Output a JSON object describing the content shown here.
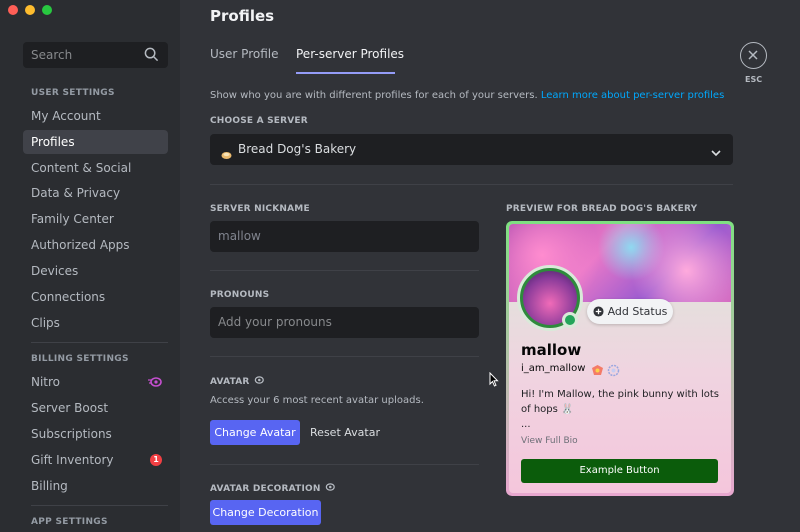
{
  "sidebar": {
    "search_placeholder": "Search",
    "sections": [
      {
        "heading": "USER SETTINGS",
        "items": [
          "My Account",
          "Profiles",
          "Content & Social",
          "Data & Privacy",
          "Family Center",
          "Authorized Apps",
          "Devices",
          "Connections",
          "Clips"
        ]
      },
      {
        "heading": "BILLING SETTINGS",
        "items": [
          "Nitro",
          "Server Boost",
          "Subscriptions",
          "Gift Inventory",
          "Billing"
        ]
      },
      {
        "heading": "APP SETTINGS",
        "items": []
      }
    ],
    "active_item": "Profiles",
    "gift_badge_count": "1"
  },
  "page": {
    "title": "Profiles",
    "tabs": [
      "User Profile",
      "Per-server Profiles"
    ],
    "active_tab": "Per-server Profiles",
    "description": "Show who you are with different profiles for each of your servers.",
    "learn_more": "Learn more about per-server profiles",
    "close_label": "ESC"
  },
  "form": {
    "choose_server_label": "CHOOSE A SERVER",
    "selected_server": "Bread Dog's Bakery",
    "nickname_label": "SERVER NICKNAME",
    "nickname_value": "mallow",
    "pronouns_label": "PRONOUNS",
    "pronouns_placeholder": "Add your pronouns",
    "avatar_label": "AVATAR",
    "avatar_desc": "Access your 6 most recent avatar uploads.",
    "change_avatar": "Change Avatar",
    "reset_avatar": "Reset Avatar",
    "decoration_label": "AVATAR DECORATION",
    "change_decoration": "Change Decoration"
  },
  "preview": {
    "label": "PREVIEW FOR BREAD DOG'S BAKERY",
    "add_status": "Add Status",
    "display_name": "mallow",
    "username": "i_am_mallow",
    "bio_line1": "Hi! I'm Mallow, the pink bunny with lots of hops 🐰",
    "bio_line2": "...",
    "view_full_bio": "View Full Bio",
    "example_button": "Example Button"
  },
  "colors": {
    "accent": "#5865f2",
    "card_border_top": "#7ee081",
    "card_border_bottom": "#e8a7cf",
    "example_button": "#0b5c0b"
  }
}
